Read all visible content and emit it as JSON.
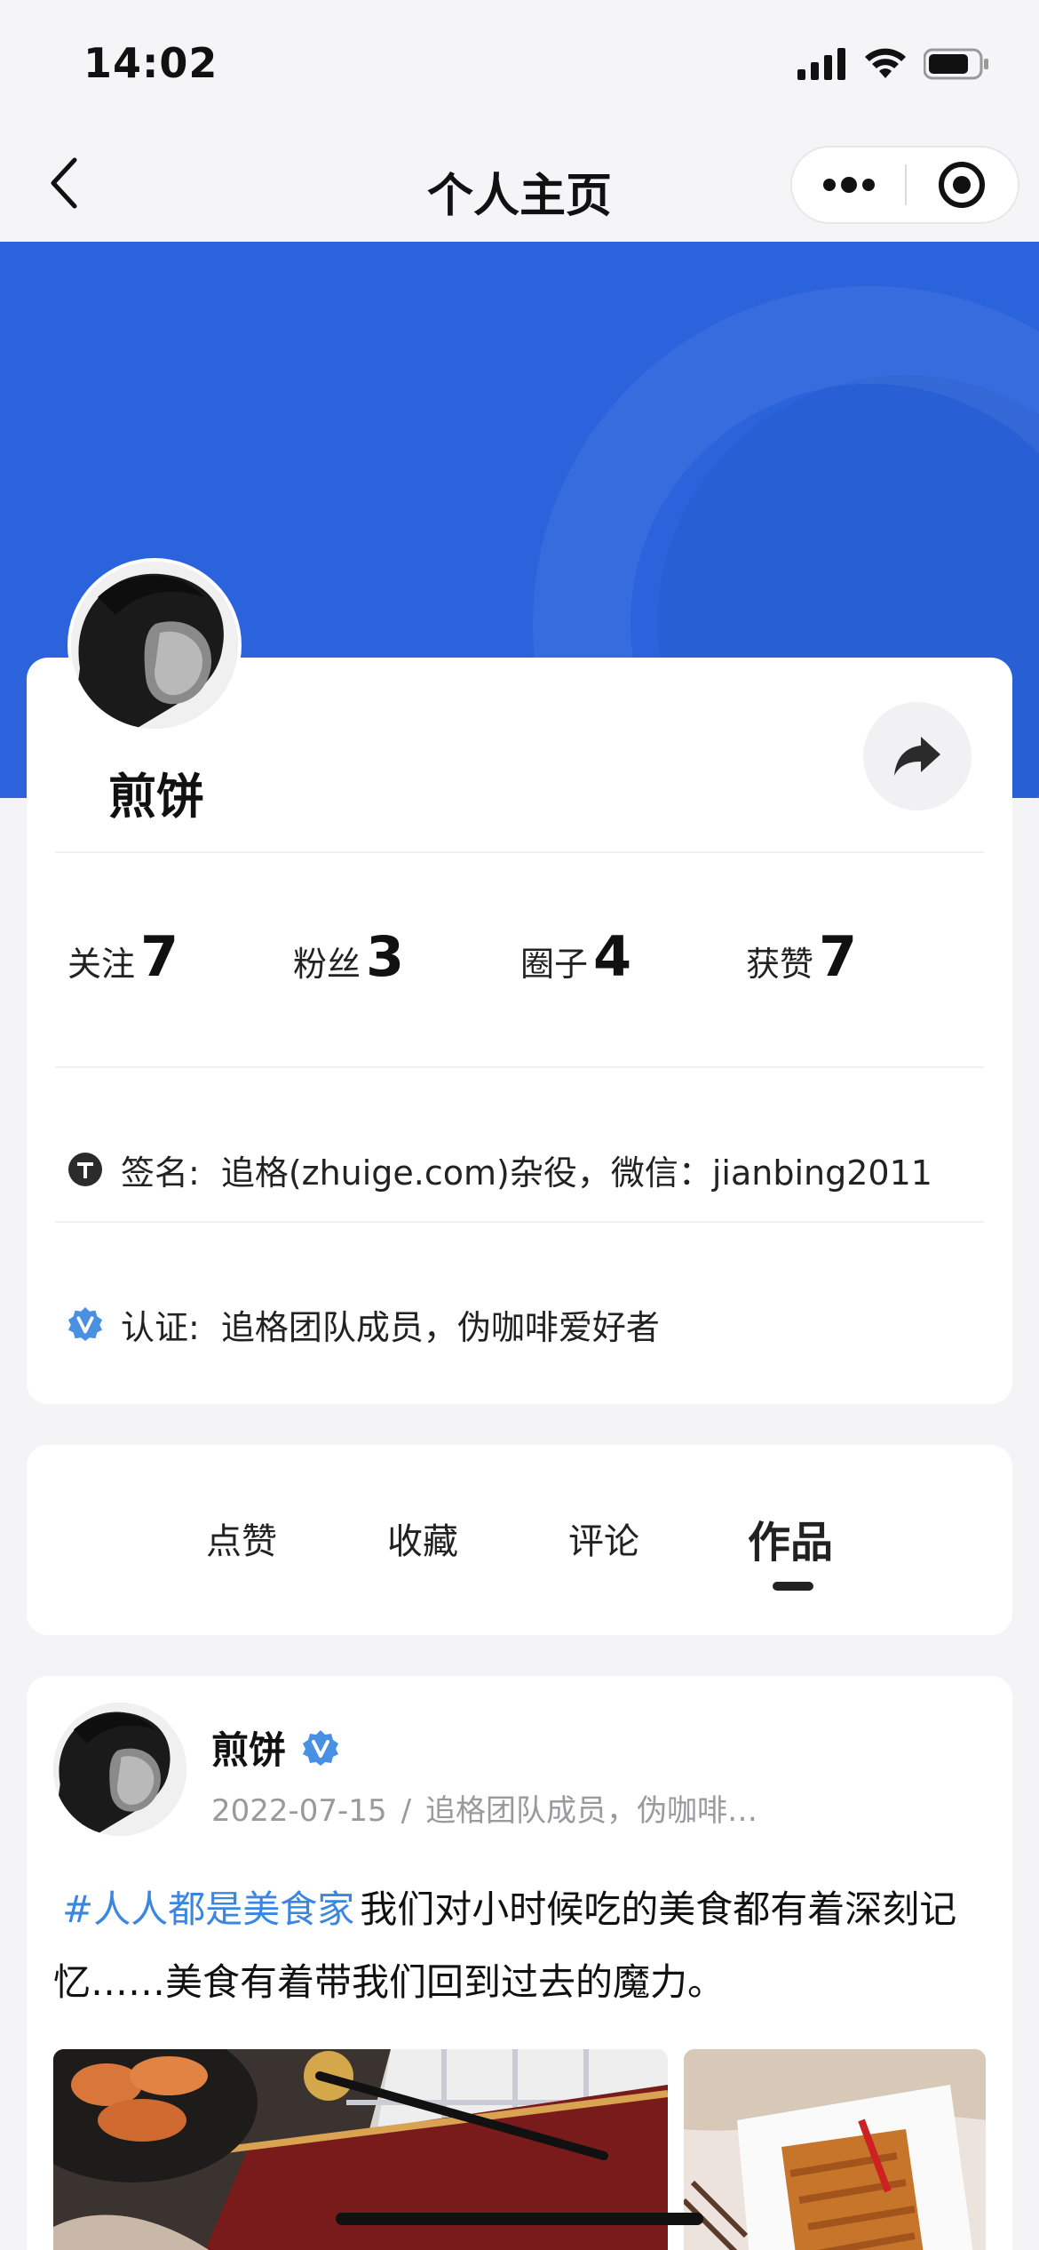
{
  "status_bar": {
    "time": "14:02"
  },
  "nav": {
    "title": "个人主页"
  },
  "profile": {
    "name": "煎饼",
    "stats": [
      {
        "label": "关注",
        "value": "7"
      },
      {
        "label": "粉丝",
        "value": "3"
      },
      {
        "label": "圈子",
        "value": "4"
      },
      {
        "label": "获赞",
        "value": "7"
      }
    ],
    "signature": {
      "label": "签名:",
      "value": "追格(zhuige.com)杂役，微信：jianbing2011"
    },
    "certification": {
      "label": "认证:",
      "value": "追格团队成员，伪咖啡爱好者"
    }
  },
  "tabs": [
    {
      "label": "点赞"
    },
    {
      "label": "收藏"
    },
    {
      "label": "评论"
    },
    {
      "label": "作品"
    }
  ],
  "active_tab": "作品",
  "post": {
    "author": "煎饼",
    "date": "2022-07-15",
    "separator": "/",
    "author_title": "追格团队成员，伪咖啡…",
    "hashtag": "#人人都是美食家",
    "text": "我们对小时候吃的美食都有着深刻记忆……美食有着带我们回到过去的魔力。"
  },
  "colors": {
    "banner": "#2a63dc",
    "hashtag": "#3a86e0",
    "verified": "#4a90e2"
  }
}
